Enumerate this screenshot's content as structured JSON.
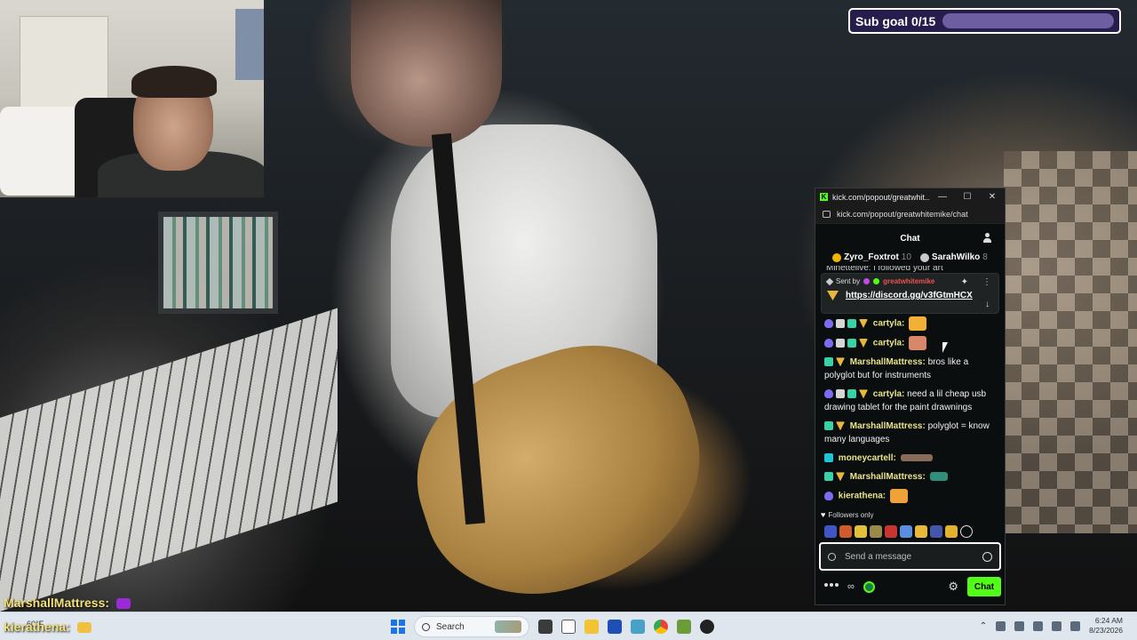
{
  "subgoal": {
    "label": "Sub goal 0/15",
    "current": 0,
    "target": 15
  },
  "overlay_chat": [
    {
      "user": "MarshallMattress:"
    },
    {
      "user": "kierathena:"
    }
  ],
  "popout": {
    "window_title": "kick.com/popout/greatwhit...",
    "url": "kick.com/popout/greatwhitemike/chat",
    "chat_title": "Chat",
    "leaderboard": [
      {
        "name": "Zyro_Foxtrot",
        "count": "10",
        "badge_color": "#f5b400"
      },
      {
        "name": "SarahWilko",
        "count": "8",
        "badge_color": "#c9c9c9"
      }
    ],
    "partial_message": "Mlnettelive: i followed your art",
    "pinned": {
      "sent_by_label": "Sent by",
      "sender": "greatwhitemike",
      "link": "https://discord.gg/v3fGtmHCX"
    },
    "messages": [
      {
        "user": "cartyla:",
        "text": ""
      },
      {
        "user": "cartyla:",
        "text": ""
      },
      {
        "user": "MarshallMattress:",
        "text": "bros like a polyglot but for instruments"
      },
      {
        "user": "cartyla:",
        "text": "need a lil cheap usb drawing tablet for the paint drawnings"
      },
      {
        "user": "MarshallMattress:",
        "text": "polyglot = know many languages"
      },
      {
        "user": "moneycartell:",
        "text": ""
      },
      {
        "user": "MarshallMattress:",
        "text": ""
      },
      {
        "user": "kierathena:",
        "text": ""
      }
    ],
    "followers_label": "Followers only",
    "input_placeholder": "Send a message",
    "send_button": "Chat",
    "accent_color": "#53fc18"
  },
  "taskbar": {
    "weather": "60°F",
    "search_label": "Search",
    "time": "6:24 AM",
    "date": "8/23/2026"
  }
}
